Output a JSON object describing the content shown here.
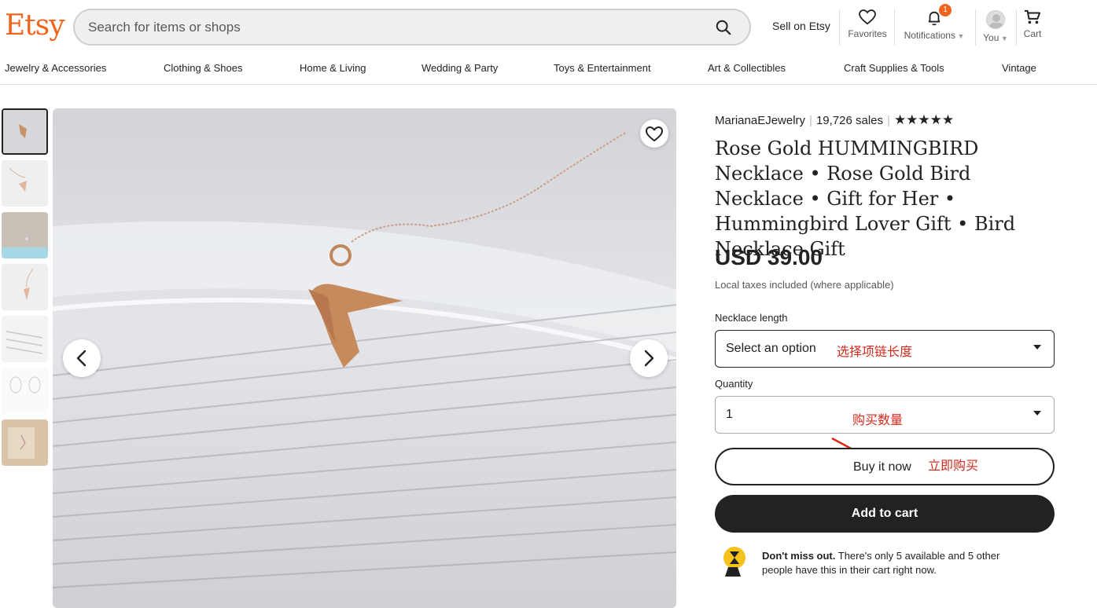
{
  "header": {
    "logo": "Etsy",
    "search_placeholder": "Search for items or shops",
    "sell_label": "Sell on Etsy",
    "favorites_label": "Favorites",
    "notifications_label": "Notifications",
    "notifications_count": "1",
    "you_label": "You",
    "cart_label": "Cart"
  },
  "categories": [
    "Jewelry & Accessories",
    "Clothing & Shoes",
    "Home & Living",
    "Wedding & Party",
    "Toys & Entertainment",
    "Art & Collectibles",
    "Craft Supplies & Tools",
    "Vintage"
  ],
  "listing": {
    "shop_name": "MarianaEJewelry",
    "sales": "19,726 sales",
    "rating_stars": "★★★★★",
    "title": "Rose Gold HUMMINGBIRD Necklace • Rose Gold Bird Necklace • Gift for Her • Hummingbird Lover Gift • Bird Necklace Gift",
    "price": "USD 39.00",
    "taxes_note": "Local taxes included (where applicable)",
    "length_label": "Necklace length",
    "length_value": "Select an option",
    "length_annotation": "选择项链长度",
    "quantity_label": "Quantity",
    "quantity_value": "1",
    "quantity_annotation": "购买数量",
    "buy_now_label": "Buy it now",
    "buy_now_annotation": "立即购买",
    "add_to_cart_label": "Add to cart",
    "urgency_bold": "Don't miss out.",
    "urgency_text": " There's only 5 available and 5 other people have this in their cart right now."
  },
  "colors": {
    "brand": "#f1641e",
    "annotation": "#d32b1e",
    "primary_button": "#222222"
  }
}
